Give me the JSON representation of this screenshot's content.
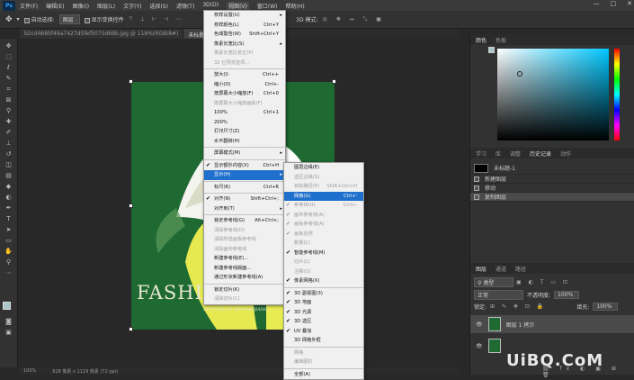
{
  "menubar": {
    "logo": "Ps",
    "items": [
      "文件(F)",
      "编辑(E)",
      "图像(I)",
      "图层(L)",
      "文字(Y)",
      "选择(S)",
      "滤镜(T)",
      "3D(D)",
      "视图(V)",
      "窗口(W)",
      "帮助(H)"
    ],
    "active_index": 8,
    "window_buttons": [
      "—",
      "□",
      "✕"
    ]
  },
  "options": {
    "auto_select_label": "自动选择:",
    "auto_select_value": "图层",
    "show_transform_label": "显示变换控件",
    "mode_label": "3D 模式:"
  },
  "tabs": [
    {
      "label": "b2cd4685f49a7427d5fef5075d69b.jpg @ 118%(RGB/8#)"
    },
    {
      "label": "未标题"
    }
  ],
  "status": {
    "zoom": "100%",
    "doc": "828 像素 x 1119 像素 (72 ppi)"
  },
  "canvas": {
    "title": "FASHION G",
    "subtitle": "PICTURE BY XINGHEJIANG"
  },
  "color_panel": {
    "tabs": [
      "颜色",
      "色板"
    ]
  },
  "history_panel": {
    "tabs": [
      "学习",
      "库",
      "调整",
      "历史记录",
      "动作"
    ],
    "doc_name": "未标题-1",
    "items": [
      "新建图层",
      "移动",
      "复制图层"
    ]
  },
  "layers_panel": {
    "tabs": [
      "图层",
      "通道",
      "路径"
    ],
    "kind_label": "类型",
    "blend": "正常",
    "opacity_label": "不透明度:",
    "opacity": "100%",
    "lock_label": "锁定:",
    "fill_label": "填充:",
    "fill": "100%",
    "layer_name": "图层 1 拷贝"
  },
  "view_menu": {
    "items": [
      {
        "label": "校样设置(U)",
        "arrow": true
      },
      {
        "label": "校样颜色(L)",
        "shortcut": "Ctrl+Y"
      },
      {
        "label": "色域警告(W)",
        "shortcut": "Shift+Ctrl+Y"
      },
      {
        "label": "像素长宽比(S)",
        "arrow": true
      },
      {
        "label": "像素长宽比校正(P)",
        "disabled": true
      },
      {
        "label": "32 位预览选项...",
        "disabled": true
      },
      {
        "sep": true
      },
      {
        "label": "放大(I)",
        "shortcut": "Ctrl++"
      },
      {
        "label": "缩小(O)",
        "shortcut": "Ctrl+-"
      },
      {
        "label": "按屏幕大小缩放(F)",
        "shortcut": "Ctrl+0"
      },
      {
        "label": "按屏幕大小缩放画板(F)",
        "disabled": true
      },
      {
        "label": "100%",
        "shortcut": "Ctrl+1"
      },
      {
        "label": "200%"
      },
      {
        "label": "打印尺寸(Z)"
      },
      {
        "label": "水平翻转(H)"
      },
      {
        "sep": true
      },
      {
        "label": "屏幕模式(M)",
        "arrow": true
      },
      {
        "sep": true
      },
      {
        "label": "显示额外内容(X)",
        "shortcut": "Ctrl+H",
        "checked": true
      },
      {
        "label": "显示(H)",
        "arrow": true,
        "highlight": true
      },
      {
        "sep": true
      },
      {
        "label": "标尺(R)",
        "shortcut": "Ctrl+R"
      },
      {
        "sep": true
      },
      {
        "label": "对齐(N)",
        "shortcut": "Shift+Ctrl+;",
        "checked": true
      },
      {
        "label": "对齐到(T)",
        "arrow": true
      },
      {
        "sep": true
      },
      {
        "label": "锁定参考线(G)",
        "shortcut": "Alt+Ctrl+;"
      },
      {
        "label": "清除参考线(D)",
        "disabled": true
      },
      {
        "label": "清除所选画板参考线",
        "disabled": true
      },
      {
        "label": "清除画布参考线",
        "disabled": true
      },
      {
        "label": "新建参考线(E)..."
      },
      {
        "label": "新建参考线版面..."
      },
      {
        "label": "通过形状新建参考线(A)"
      },
      {
        "sep": true
      },
      {
        "label": "锁定切片(K)"
      },
      {
        "label": "清除切片(C)",
        "disabled": true
      }
    ]
  },
  "show_menu": {
    "items": [
      {
        "label": "图层边缘(E)"
      },
      {
        "label": "选区边缘(S)",
        "disabled": true
      },
      {
        "label": "目标路径(P)",
        "shortcut": "Shift+Ctrl+H",
        "disabled": true
      },
      {
        "label": "网格(G)",
        "shortcut": "Ctrl+'",
        "highlight": true
      },
      {
        "label": "参考线(U)",
        "shortcut": "Ctrl+;",
        "disabled": true,
        "checked": true
      },
      {
        "label": "画布参考线(A)",
        "disabled": true,
        "checked": true
      },
      {
        "label": "画板参考线(A)",
        "disabled": true,
        "checked": true
      },
      {
        "label": "画板名称",
        "disabled": true,
        "checked": true
      },
      {
        "label": "数量(C)",
        "disabled": true
      },
      {
        "label": "智能参考线(M)",
        "checked": true
      },
      {
        "label": "切片(L)",
        "disabled": true
      },
      {
        "label": "注释(O)",
        "disabled": true
      },
      {
        "label": "像素网格(X)",
        "checked": true
      },
      {
        "sep": true
      },
      {
        "label": "3D 副视图(3)",
        "checked": true
      },
      {
        "label": "3D 地面",
        "checked": true
      },
      {
        "label": "3D 光源",
        "checked": true
      },
      {
        "label": "3D 选区",
        "checked": true
      },
      {
        "label": "UV 叠加",
        "checked": true
      },
      {
        "label": "3D 网格外框"
      },
      {
        "sep": true
      },
      {
        "label": "网格",
        "disabled": true
      },
      {
        "label": "编辑图钉",
        "disabled": true
      },
      {
        "sep": true
      },
      {
        "label": "全部(A)"
      }
    ]
  },
  "watermark": "UiBQ.CoM",
  "colors": {
    "accent": "#1e70cc",
    "canvas_green": "#1e6a32",
    "figure_yellow": "#e5ea4f"
  }
}
